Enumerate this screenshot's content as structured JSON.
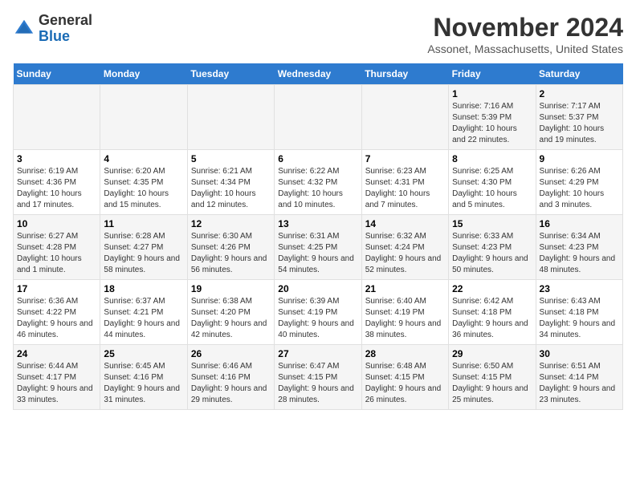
{
  "logo": {
    "general": "General",
    "blue": "Blue"
  },
  "header": {
    "month": "November 2024",
    "location": "Assonet, Massachusetts, United States"
  },
  "days_of_week": [
    "Sunday",
    "Monday",
    "Tuesday",
    "Wednesday",
    "Thursday",
    "Friday",
    "Saturday"
  ],
  "weeks": [
    [
      {
        "day": "",
        "info": ""
      },
      {
        "day": "",
        "info": ""
      },
      {
        "day": "",
        "info": ""
      },
      {
        "day": "",
        "info": ""
      },
      {
        "day": "",
        "info": ""
      },
      {
        "day": "1",
        "info": "Sunrise: 7:16 AM\nSunset: 5:39 PM\nDaylight: 10 hours and 22 minutes."
      },
      {
        "day": "2",
        "info": "Sunrise: 7:17 AM\nSunset: 5:37 PM\nDaylight: 10 hours and 19 minutes."
      }
    ],
    [
      {
        "day": "3",
        "info": "Sunrise: 6:19 AM\nSunset: 4:36 PM\nDaylight: 10 hours and 17 minutes."
      },
      {
        "day": "4",
        "info": "Sunrise: 6:20 AM\nSunset: 4:35 PM\nDaylight: 10 hours and 15 minutes."
      },
      {
        "day": "5",
        "info": "Sunrise: 6:21 AM\nSunset: 4:34 PM\nDaylight: 10 hours and 12 minutes."
      },
      {
        "day": "6",
        "info": "Sunrise: 6:22 AM\nSunset: 4:32 PM\nDaylight: 10 hours and 10 minutes."
      },
      {
        "day": "7",
        "info": "Sunrise: 6:23 AM\nSunset: 4:31 PM\nDaylight: 10 hours and 7 minutes."
      },
      {
        "day": "8",
        "info": "Sunrise: 6:25 AM\nSunset: 4:30 PM\nDaylight: 10 hours and 5 minutes."
      },
      {
        "day": "9",
        "info": "Sunrise: 6:26 AM\nSunset: 4:29 PM\nDaylight: 10 hours and 3 minutes."
      }
    ],
    [
      {
        "day": "10",
        "info": "Sunrise: 6:27 AM\nSunset: 4:28 PM\nDaylight: 10 hours and 1 minute."
      },
      {
        "day": "11",
        "info": "Sunrise: 6:28 AM\nSunset: 4:27 PM\nDaylight: 9 hours and 58 minutes."
      },
      {
        "day": "12",
        "info": "Sunrise: 6:30 AM\nSunset: 4:26 PM\nDaylight: 9 hours and 56 minutes."
      },
      {
        "day": "13",
        "info": "Sunrise: 6:31 AM\nSunset: 4:25 PM\nDaylight: 9 hours and 54 minutes."
      },
      {
        "day": "14",
        "info": "Sunrise: 6:32 AM\nSunset: 4:24 PM\nDaylight: 9 hours and 52 minutes."
      },
      {
        "day": "15",
        "info": "Sunrise: 6:33 AM\nSunset: 4:23 PM\nDaylight: 9 hours and 50 minutes."
      },
      {
        "day": "16",
        "info": "Sunrise: 6:34 AM\nSunset: 4:23 PM\nDaylight: 9 hours and 48 minutes."
      }
    ],
    [
      {
        "day": "17",
        "info": "Sunrise: 6:36 AM\nSunset: 4:22 PM\nDaylight: 9 hours and 46 minutes."
      },
      {
        "day": "18",
        "info": "Sunrise: 6:37 AM\nSunset: 4:21 PM\nDaylight: 9 hours and 44 minutes."
      },
      {
        "day": "19",
        "info": "Sunrise: 6:38 AM\nSunset: 4:20 PM\nDaylight: 9 hours and 42 minutes."
      },
      {
        "day": "20",
        "info": "Sunrise: 6:39 AM\nSunset: 4:19 PM\nDaylight: 9 hours and 40 minutes."
      },
      {
        "day": "21",
        "info": "Sunrise: 6:40 AM\nSunset: 4:19 PM\nDaylight: 9 hours and 38 minutes."
      },
      {
        "day": "22",
        "info": "Sunrise: 6:42 AM\nSunset: 4:18 PM\nDaylight: 9 hours and 36 minutes."
      },
      {
        "day": "23",
        "info": "Sunrise: 6:43 AM\nSunset: 4:18 PM\nDaylight: 9 hours and 34 minutes."
      }
    ],
    [
      {
        "day": "24",
        "info": "Sunrise: 6:44 AM\nSunset: 4:17 PM\nDaylight: 9 hours and 33 minutes."
      },
      {
        "day": "25",
        "info": "Sunrise: 6:45 AM\nSunset: 4:16 PM\nDaylight: 9 hours and 31 minutes."
      },
      {
        "day": "26",
        "info": "Sunrise: 6:46 AM\nSunset: 4:16 PM\nDaylight: 9 hours and 29 minutes."
      },
      {
        "day": "27",
        "info": "Sunrise: 6:47 AM\nSunset: 4:15 PM\nDaylight: 9 hours and 28 minutes."
      },
      {
        "day": "28",
        "info": "Sunrise: 6:48 AM\nSunset: 4:15 PM\nDaylight: 9 hours and 26 minutes."
      },
      {
        "day": "29",
        "info": "Sunrise: 6:50 AM\nSunset: 4:15 PM\nDaylight: 9 hours and 25 minutes."
      },
      {
        "day": "30",
        "info": "Sunrise: 6:51 AM\nSunset: 4:14 PM\nDaylight: 9 hours and 23 minutes."
      }
    ]
  ],
  "colors": {
    "header_bg": "#2e7bcf",
    "odd_row": "#f5f5f5",
    "even_row": "#ffffff"
  }
}
